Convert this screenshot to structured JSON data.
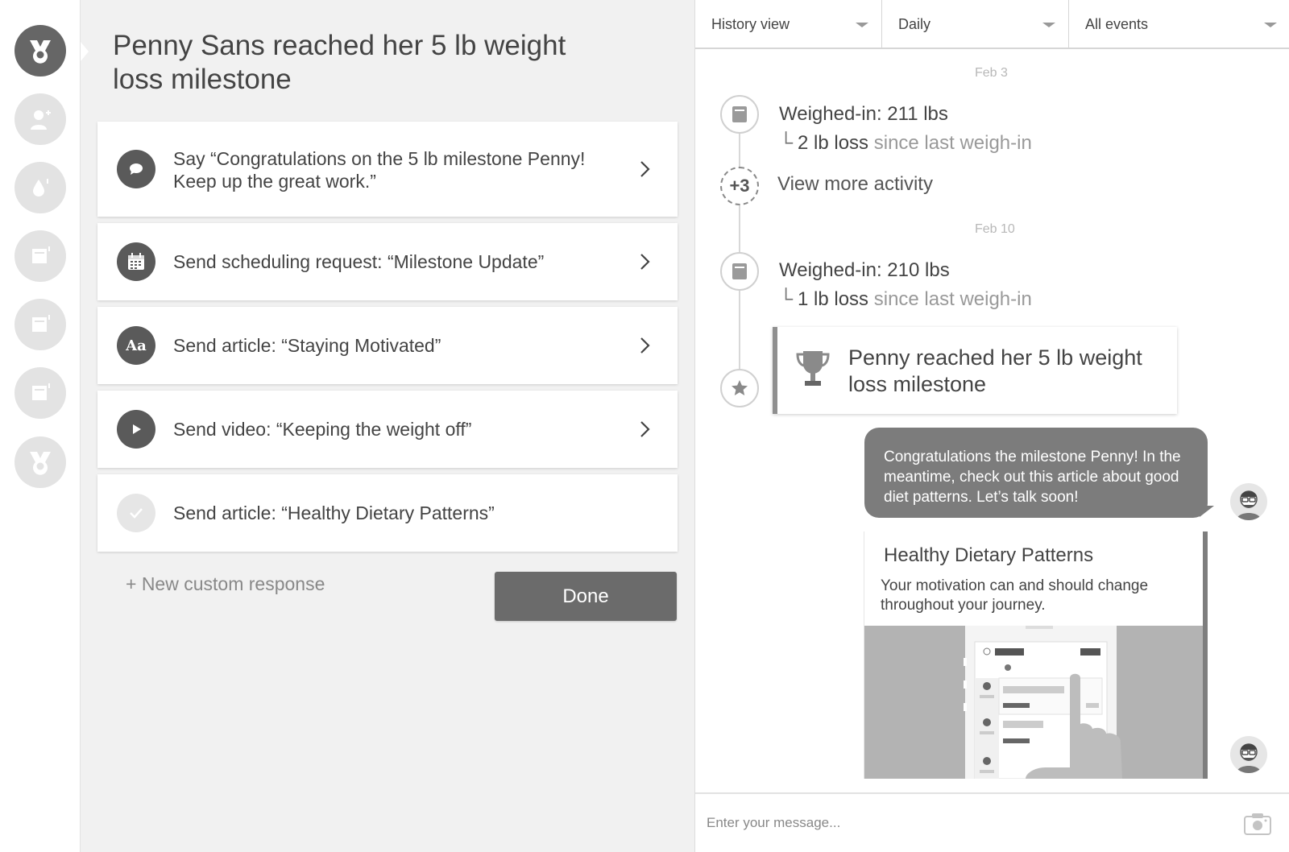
{
  "mid": {
    "title": "Penny Sans reached her 5 lb weight loss milestone",
    "responses": [
      {
        "icon": "chat-bubble-icon",
        "text": "Say “Congratulations on the 5 lb milestone Penny! Keep up the great work.”",
        "state": "pending"
      },
      {
        "icon": "calendar-icon",
        "text": "Send scheduling request: “Milestone Update”",
        "state": "pending"
      },
      {
        "icon": "article-icon",
        "text": "Send article: “Staying Motivated”",
        "state": "pending"
      },
      {
        "icon": "play-icon",
        "text": "Send video: “Keeping the weight off”",
        "state": "pending"
      },
      {
        "icon": "check-icon",
        "text": "Send article: “Healthy Dietary Patterns”",
        "state": "sent"
      }
    ],
    "article_icon_text": "Aa",
    "new_response": "+ New custom response",
    "done_label": "Done"
  },
  "filters": [
    {
      "label": "History view"
    },
    {
      "label": "Daily"
    },
    {
      "label": "All events"
    }
  ],
  "timeline": {
    "date1": "Feb 3",
    "weigh1": "Weighed-in: 211 lbs",
    "loss1_strong": "2 lb loss",
    "loss1_muted": "since last weigh-in",
    "more_count": "+3",
    "more_label": "View more activity",
    "date2": "Feb 10",
    "weigh2": "Weighed-in: 210 lbs",
    "loss2_strong": "1 lb loss",
    "loss2_muted": "since last weigh-in",
    "milestone": "Penny reached her 5 lb weight loss milestone",
    "branch_glyph": "└"
  },
  "chat": {
    "message": "Congratulations the milestone Penny! In the meantime, check out this article about good diet patterns. Let’s talk soon!",
    "article_title": "Healthy Dietary Patterns",
    "article_desc": "Your motivation can and should change throughout your journey."
  },
  "compose": {
    "placeholder": "Enter your message..."
  },
  "colors": {
    "accent_dark": "#5a5a5a",
    "panel_bg": "#f1f1f1",
    "bubble": "#7c7c7c"
  }
}
